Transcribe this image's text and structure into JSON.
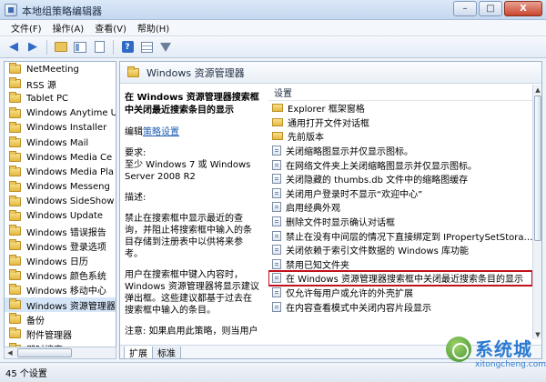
{
  "window": {
    "title": "本地组策略编辑器",
    "buttons": {
      "minimize": "–",
      "maximize": "□",
      "close": "X"
    }
  },
  "menu": [
    "文件(F)",
    "操作(A)",
    "查看(V)",
    "帮助(H)"
  ],
  "toolbar_icons": [
    "back-arrow-icon",
    "forward-arrow-icon",
    "folder-up-icon",
    "show-hide-tree-icon",
    "properties-icon",
    "help-icon",
    "view-grid-icon",
    "filter-icon"
  ],
  "tree": {
    "items": [
      "NetMeeting",
      "RSS 源",
      "Tablet PC",
      "Windows Anytime U",
      "Windows Installer",
      "Windows Mail",
      "Windows Media Ce",
      "Windows Media Pla",
      "Windows Messeng",
      "Windows SideShow",
      "Windows Update",
      "Windows 错误报告",
      "Windows 登录选项",
      "Windows 日历",
      "Windows 颜色系统",
      "Windows 移动中心",
      "Windows 资源管理器",
      "备份",
      "附件管理器",
      "即时搜索"
    ],
    "selected_index": 16
  },
  "right_pane": {
    "header": "Windows 资源管理器",
    "description": {
      "title": "在 Windows 资源管理器搜索框中关闭最近搜索条目的显示",
      "edit_prefix": "编辑",
      "edit_link": "策略设置",
      "requirements_label": "要求:",
      "requirements_text": "至少 Windows 7 或 Windows Server 2008 R2",
      "desc_label": "描述:",
      "desc_p1": "禁止在搜索框中显示最近的查询，并阻止将搜索框中输入的条目存储到注册表中以供将来参考。",
      "desc_p2": "用户在搜索框中键入内容时，Windows 资源管理器将显示建议弹出框。这些建议都基于过去在搜索框中输入的条目。",
      "desc_p3": "注意: 如果启用此策略，则当用户"
    },
    "list_header": "设置",
    "rows": [
      {
        "type": "folder",
        "text": "Explorer 框架窗格"
      },
      {
        "type": "folder",
        "text": "通用打开文件对话框"
      },
      {
        "type": "folder",
        "text": "先前版本"
      },
      {
        "type": "setting",
        "text": "关闭缩略图显示并仅显示图标。"
      },
      {
        "type": "setting",
        "text": "在网络文件夹上关闭缩略图显示并仅显示图标。"
      },
      {
        "type": "setting",
        "text": "关闭隐藏的 thumbs.db 文件中的缩略图缓存"
      },
      {
        "type": "setting",
        "text": "关闭用户登录时不显示“欢迎中心”"
      },
      {
        "type": "setting",
        "text": "启用经典外观"
      },
      {
        "type": "setting",
        "text": "删除文件时显示确认对话框"
      },
      {
        "type": "setting",
        "text": "禁止在没有中间层的情况下直接绑定到 IPropertySetStora…"
      },
      {
        "type": "setting",
        "text": "关闭依赖于索引文件数据的 Windows 库功能"
      },
      {
        "type": "setting",
        "text": "禁用已知文件夹"
      },
      {
        "type": "setting",
        "text": "在 Windows 资源管理器搜索框中关闭最近搜索条目的显示"
      },
      {
        "type": "setting",
        "text": "仅允许每用户或允许的外壳扩展"
      },
      {
        "type": "setting",
        "text": "在内容查看模式中关闭内容片段显示"
      }
    ],
    "highlight_index": 12,
    "tabs": [
      "扩展",
      "标准"
    ]
  },
  "statusbar": {
    "text": "45 个设置"
  },
  "watermark": {
    "brand": "系统城",
    "site": "xitongcheng.com"
  },
  "colors": {
    "highlight_outline": "#c1121c",
    "link": "#1e5cb3",
    "brand": "#2d7bd1"
  }
}
